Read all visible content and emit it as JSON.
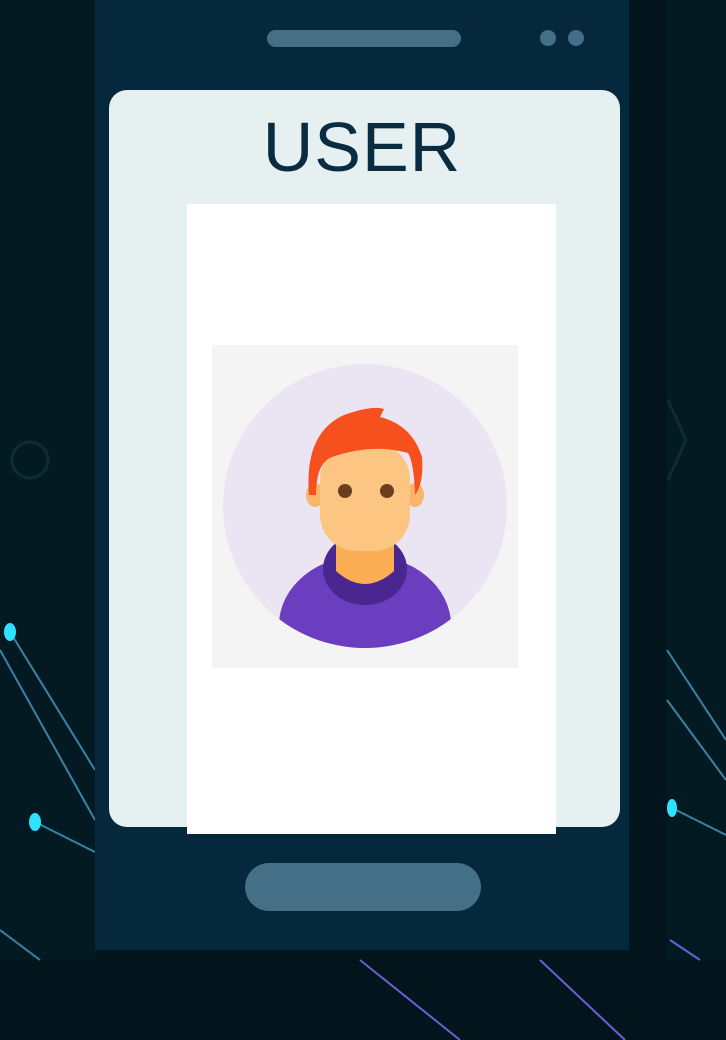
{
  "screen": {
    "title": "USER"
  },
  "icons": {
    "avatar": "user-avatar-icon",
    "speaker": "speaker-slot",
    "camera": "camera-dots",
    "home": "home-button"
  },
  "colors": {
    "background": "#02141c",
    "phone_body": "#06283d",
    "screen": "#e7f0f0",
    "accent_controls": "#456f86",
    "title_text": "#0a2c40",
    "avatar_circle": "#ebe5f3",
    "hair": "#f5501e",
    "skin": "#fcc581",
    "shirt": "#6a3ebf",
    "network_nodes": "#2ee2ff"
  }
}
